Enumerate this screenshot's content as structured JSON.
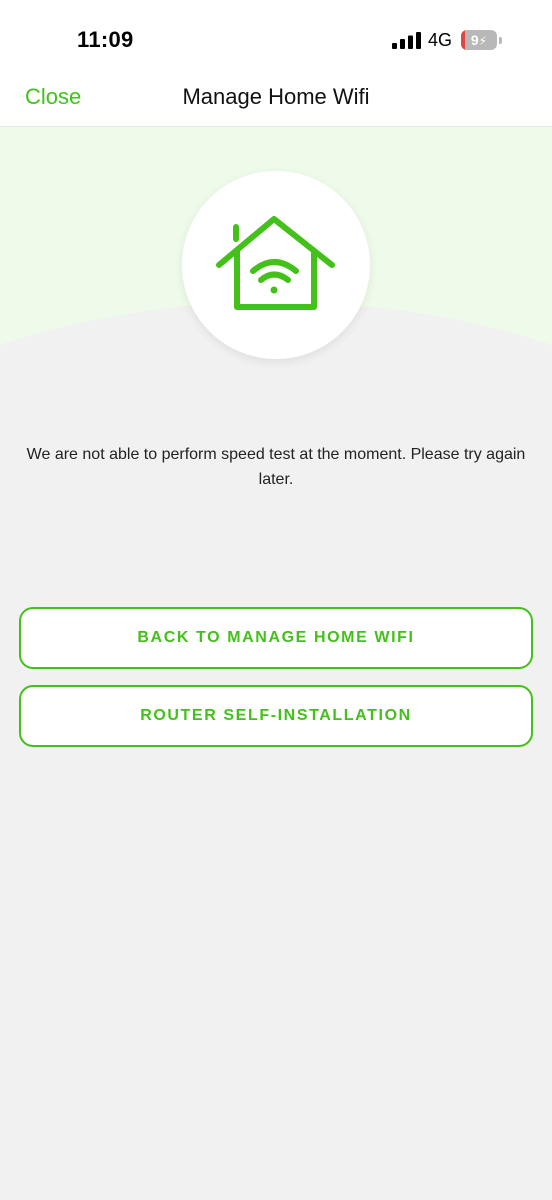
{
  "status_bar": {
    "time": "11:09",
    "network": "4G",
    "battery": "9"
  },
  "nav": {
    "close_label": "Close",
    "title": "Manage Home Wifi"
  },
  "hero": {
    "icon": "home-wifi-icon"
  },
  "message": "We are not able to perform speed test at the moment. Please try again later.",
  "buttons": {
    "back_label": "BACK TO MANAGE HOME WIFI",
    "router_label": "ROUTER SELF-INSTALLATION"
  },
  "colors": {
    "accent": "#43c11a",
    "hero_bg": "#effbea",
    "page_bg": "#f1f1f1",
    "battery_low": "#e1473f"
  }
}
